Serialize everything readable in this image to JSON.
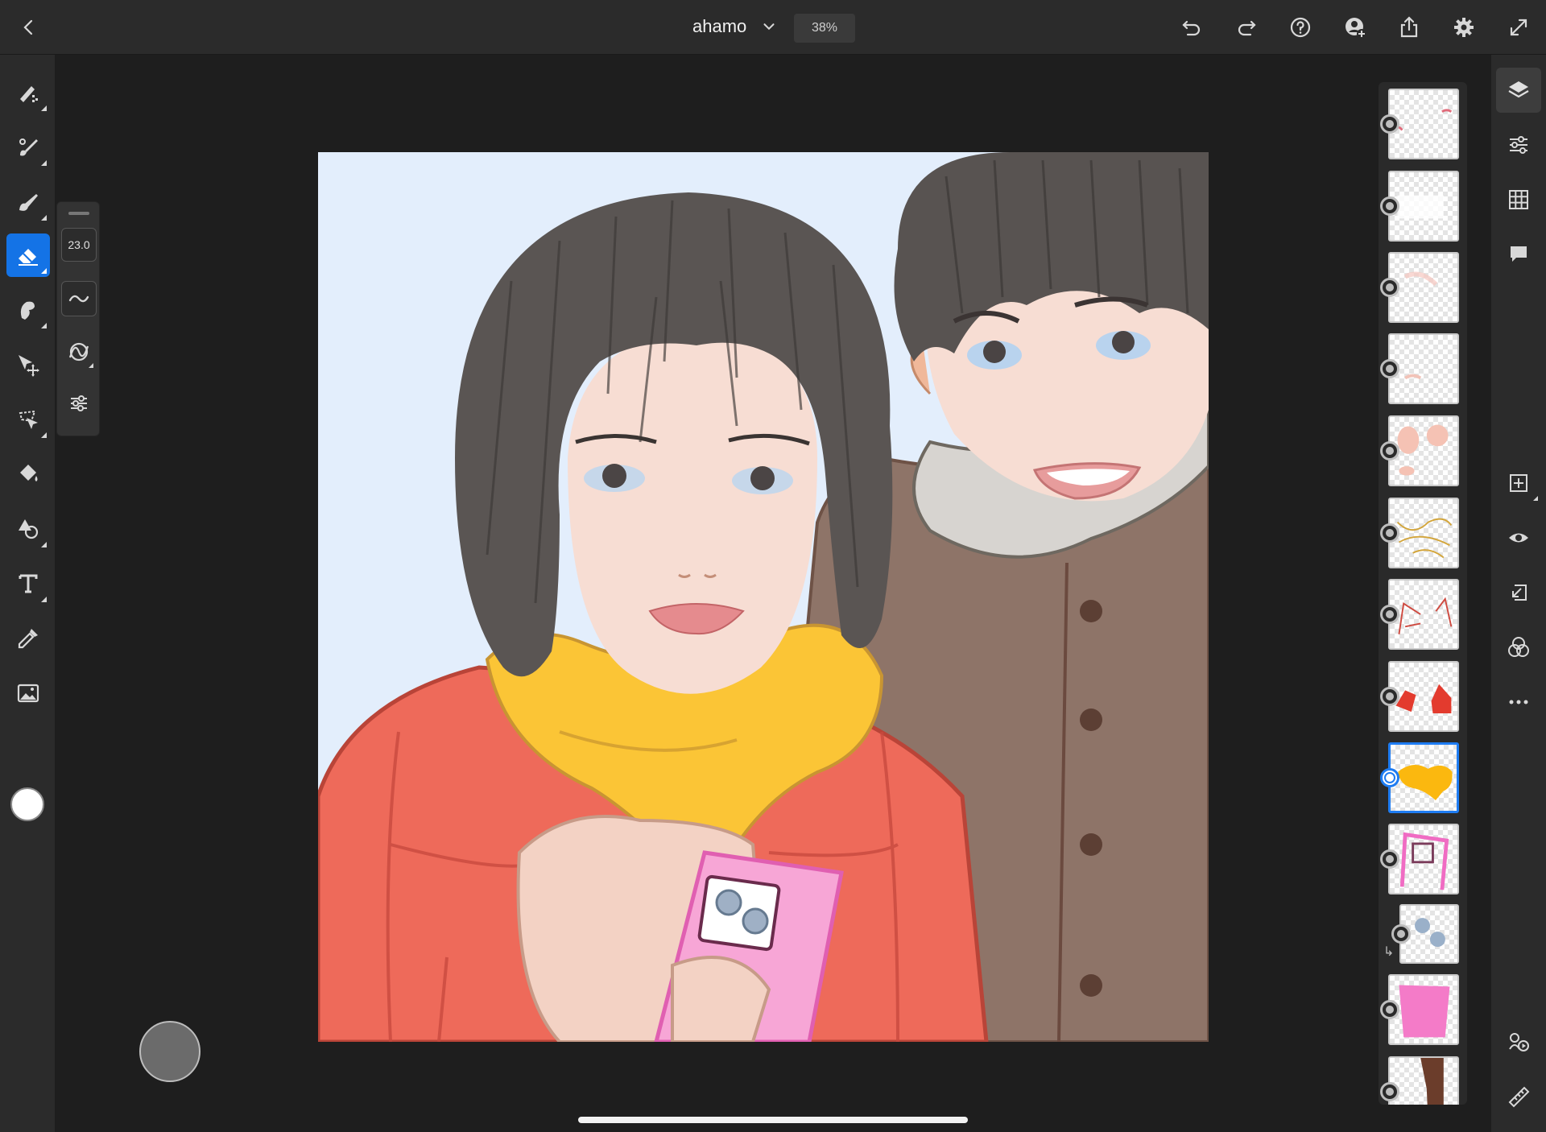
{
  "app": {
    "document_title": "ahamo",
    "zoom": "38%"
  },
  "topbar": {
    "icons": [
      "back-icon",
      "chevron-down-icon",
      "undo-icon",
      "redo-icon",
      "help-icon",
      "invite-icon",
      "share-icon",
      "settings-icon",
      "fullscreen-icon"
    ]
  },
  "toolbar": {
    "tools": [
      "pixel-brush-tool",
      "live-brush-tool",
      "vector-brush-tool",
      "eraser-tool",
      "smudge-tool",
      "transform-tool",
      "selection-tool",
      "fill-tool",
      "shapes-tool",
      "type-tool",
      "eyedropper-tool",
      "place-image-tool"
    ],
    "active_tool": "eraser-tool",
    "current_color": "#ffffff"
  },
  "tool_options": {
    "size": "23.0",
    "items": [
      "smoothing-icon",
      "flow-icon",
      "brush-settings-icon"
    ]
  },
  "layers": {
    "count": 13,
    "selected_index": 8,
    "clipped_index": 10
  },
  "right_panel": {
    "icons": [
      "layers-icon",
      "layer-properties-icon",
      "grid-icon",
      "comments-icon",
      "add-layer-icon",
      "visibility-icon",
      "import-icon",
      "blend-icon",
      "more-icon",
      "livestream-icon",
      "ruler-icon"
    ]
  },
  "colors": {
    "accent": "#1473e6",
    "panel_bg": "#2b2b2b",
    "workspace_bg": "#1e1e1e"
  }
}
